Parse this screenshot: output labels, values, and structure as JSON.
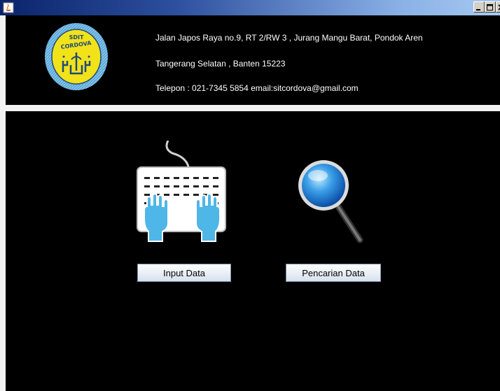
{
  "window": {
    "title": "",
    "controls": [
      "minimize",
      "maximize",
      "close"
    ]
  },
  "header": {
    "logo": {
      "top_text": "SDIT",
      "name": "CORDOVA"
    },
    "address_line1": "Jalan Japos Raya no.9, RT 2/RW 3 , Jurang Mangu Barat, Pondok Aren",
    "address_line2": "Tangerang Selatan , Banten 15223",
    "contact_line": "Telepon : 021-7345 5854  email:sitcordova@gmail.com"
  },
  "menu": {
    "input_data": {
      "label": "Input Data",
      "icon": "keyboard-hands-icon"
    },
    "search_data": {
      "label": "Pencarian Data",
      "icon": "magnifier-icon"
    }
  },
  "colors": {
    "background": "#000000",
    "title_bar": "#0a246a",
    "logo_yellow": "#f2e21a",
    "logo_blue": "#5aa8d8"
  }
}
